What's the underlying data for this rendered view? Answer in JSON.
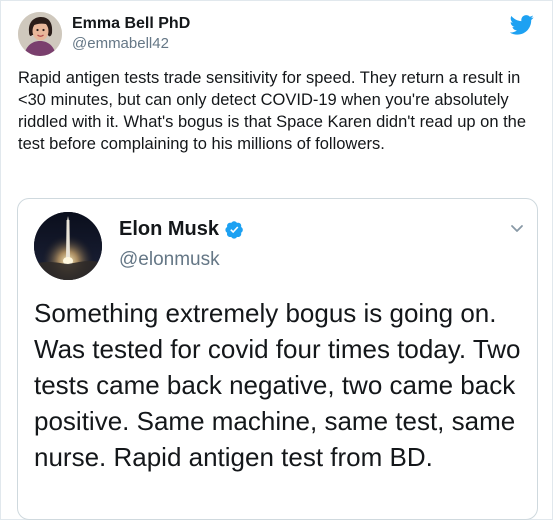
{
  "tweet": {
    "author": {
      "name": "Emma Bell PhD",
      "handle": "@emmabell42"
    },
    "text": "Rapid antigen tests trade sensitivity for speed. They return a result in <30 minutes, but can only detect COVID-19 when you're absolutely riddled with it. What's bogus is that Space Karen didn't read up on the test before complaining to his millions of followers.",
    "brand_icon": "twitter-bird-icon"
  },
  "quoted_tweet": {
    "author": {
      "name": "Elon Musk",
      "handle": "@elonmusk",
      "verified_icon": "verified-badge-icon"
    },
    "text": "Something extremely bogus is going on. Was tested for covid four times today. Two tests came back negative, two came back positive. Same machine, same test, same nurse. Rapid antigen test from BD.",
    "menu_icon": "chevron-down-icon"
  },
  "colors": {
    "text_primary": "#14171a",
    "text_secondary": "#657786",
    "twitter_blue": "#1da1f2",
    "border": "#cfd9de"
  }
}
